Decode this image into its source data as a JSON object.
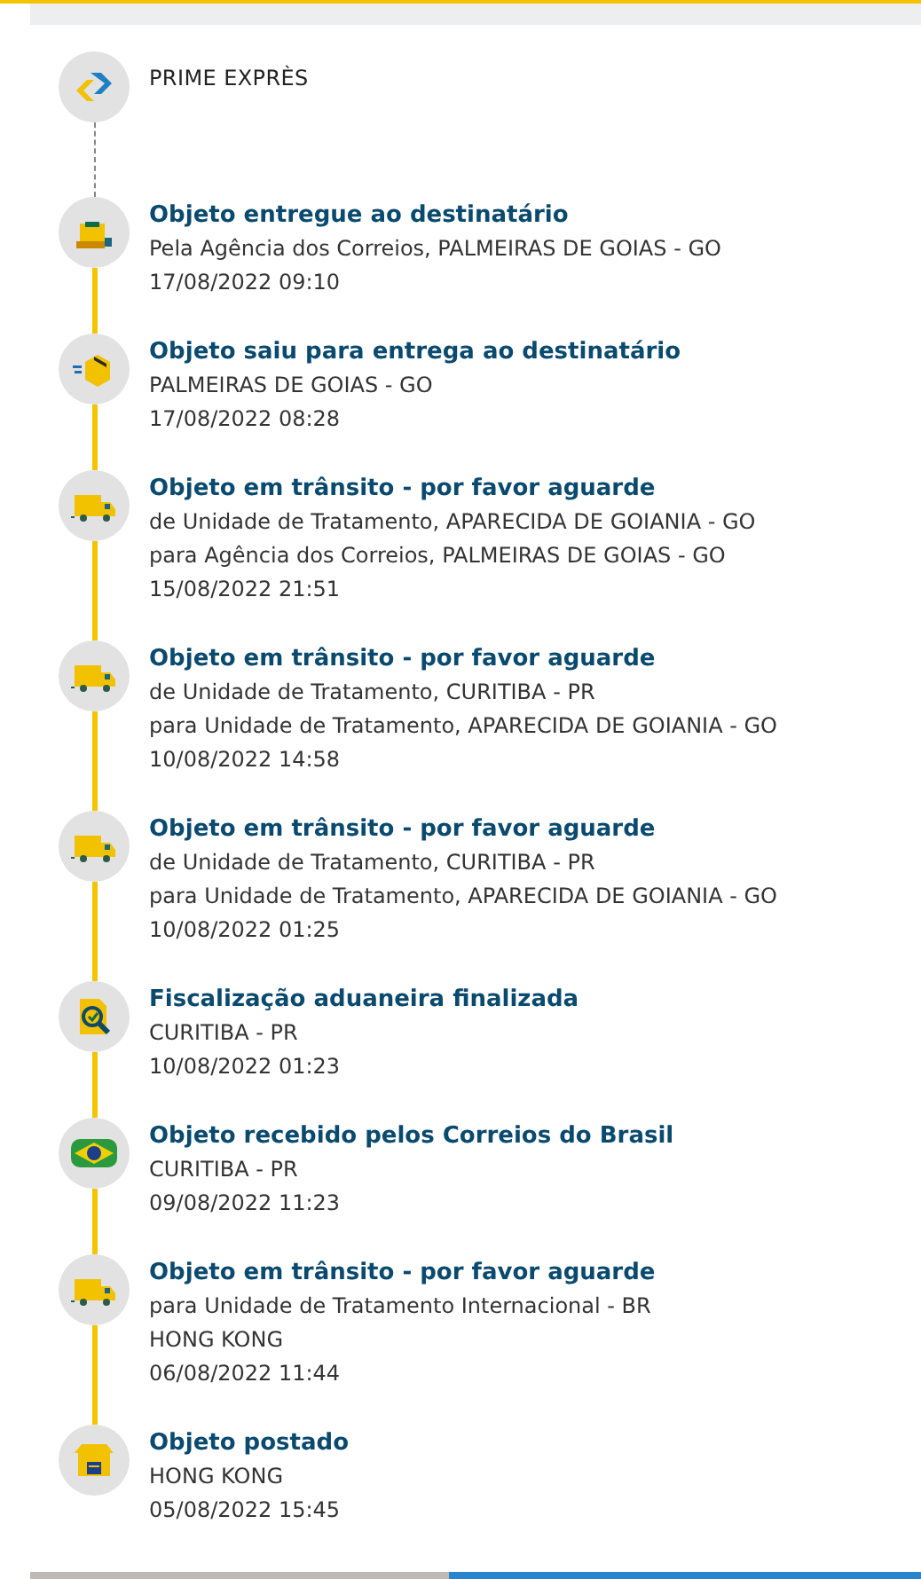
{
  "service": {
    "name": "PRIME EXPRÈS"
  },
  "events": [
    {
      "kind": "delivered",
      "title": "Objeto entregue ao destinatário",
      "details": [
        "Pela Agência dos Correios, PALMEIRAS DE GOIAS - GO"
      ],
      "datetime": "17/08/2022 09:10"
    },
    {
      "kind": "out_for_delivery",
      "title": "Objeto saiu para entrega ao destinatário",
      "details": [
        "PALMEIRAS DE GOIAS - GO"
      ],
      "datetime": "17/08/2022 08:28"
    },
    {
      "kind": "transit",
      "title": "Objeto em trânsito - por favor aguarde",
      "details": [
        "de Unidade de Tratamento, APARECIDA DE GOIANIA - GO",
        "para Agência dos Correios, PALMEIRAS DE GOIAS - GO"
      ],
      "datetime": "15/08/2022 21:51"
    },
    {
      "kind": "transit",
      "title": "Objeto em trânsito - por favor aguarde",
      "details": [
        "de Unidade de Tratamento, CURITIBA - PR",
        "para Unidade de Tratamento, APARECIDA DE GOIANIA - GO"
      ],
      "datetime": "10/08/2022 14:58"
    },
    {
      "kind": "transit",
      "title": "Objeto em trânsito - por favor aguarde",
      "details": [
        "de Unidade de Tratamento, CURITIBA - PR",
        "para Unidade de Tratamento, APARECIDA DE GOIANIA - GO"
      ],
      "datetime": "10/08/2022 01:25"
    },
    {
      "kind": "customs",
      "title": "Fiscalização aduaneira finalizada",
      "details": [
        "CURITIBA - PR"
      ],
      "datetime": "10/08/2022 01:23"
    },
    {
      "kind": "received",
      "title": "Objeto recebido pelos Correios do Brasil",
      "details": [
        "CURITIBA - PR"
      ],
      "datetime": "09/08/2022 11:23"
    },
    {
      "kind": "transit",
      "title": "Objeto em trânsito - por favor aguarde",
      "details": [
        "para Unidade de Tratamento Internacional - BR",
        "HONG KONG"
      ],
      "datetime": "06/08/2022 11:44"
    },
    {
      "kind": "posted",
      "title": "Objeto postado",
      "details": [
        "HONG KONG"
      ],
      "datetime": "05/08/2022 15:45"
    }
  ]
}
